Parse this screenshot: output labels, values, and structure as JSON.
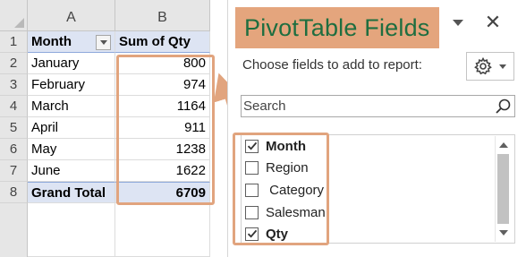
{
  "sheet": {
    "columns": [
      "A",
      "B"
    ],
    "row_numbers": [
      "1",
      "2",
      "3",
      "4",
      "5",
      "6",
      "7",
      "8"
    ],
    "header": {
      "month": "Month",
      "sum_qty": "Sum of Qty"
    },
    "rows": [
      {
        "month": "January",
        "qty": "800"
      },
      {
        "month": "February",
        "qty": "974"
      },
      {
        "month": "March",
        "qty": "1164"
      },
      {
        "month": "April",
        "qty": "911"
      },
      {
        "month": "May",
        "qty": "1238"
      },
      {
        "month": "June",
        "qty": "1622"
      }
    ],
    "total": {
      "label": "Grand Total",
      "qty": "6709"
    }
  },
  "pane": {
    "title": "PivotTable Fields",
    "close_icon": "close-icon",
    "subtitle": "Choose fields to add to report:",
    "settings_icon": "gear-icon",
    "search": {
      "placeholder": "Search",
      "value": ""
    },
    "fields": [
      {
        "name": "Month",
        "checked": true
      },
      {
        "name": "Region",
        "checked": false
      },
      {
        "name": " Category",
        "checked": false
      },
      {
        "name": "Salesman",
        "checked": false
      },
      {
        "name": "Qty",
        "checked": true
      }
    ]
  },
  "colors": {
    "highlight": "#e1a47e",
    "title_background": "#e4a57d",
    "title_text": "#1e6e40",
    "pivot_header_fill": "#dde4f3"
  }
}
